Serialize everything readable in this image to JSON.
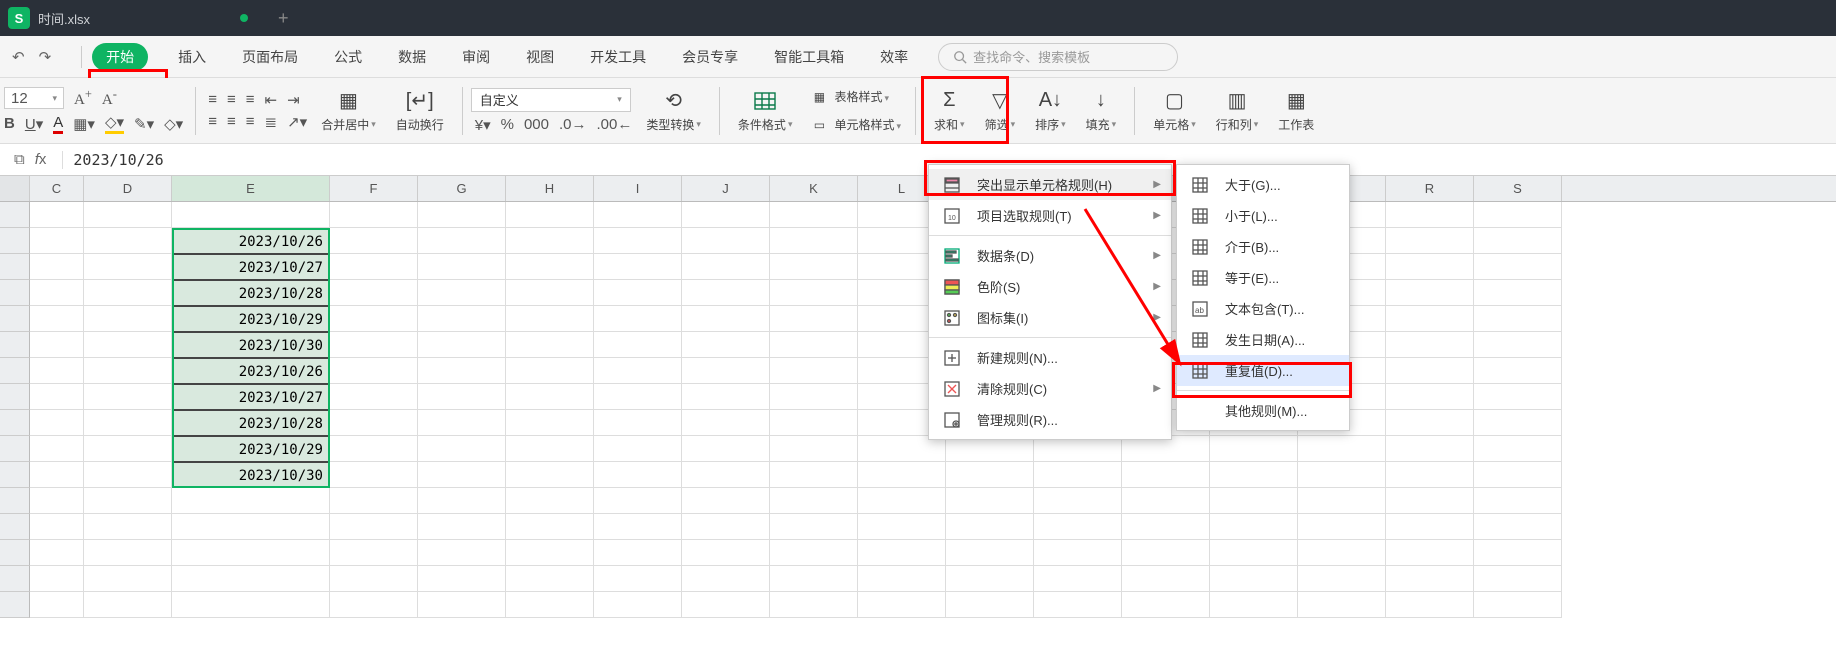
{
  "titlebar": {
    "app_letter": "S",
    "filename": "时间.xlsx",
    "new_tab": "+"
  },
  "menu": {
    "undo": "↶",
    "redo": "↷",
    "tabs": [
      "开始",
      "插入",
      "页面布局",
      "公式",
      "数据",
      "审阅",
      "视图",
      "开发工具",
      "会员专享",
      "智能工具箱",
      "效率"
    ],
    "active_index": 0,
    "search_placeholder": "查找命令、搜索模板"
  },
  "ribbon": {
    "font_size": "12",
    "merge": "合并居中",
    "wrap": "自动换行",
    "number_format": "自定义",
    "type_convert": "类型转换",
    "cond_format": "条件格式",
    "table_style": "表格样式",
    "cell_style": "单元格样式",
    "sum": "求和",
    "filter": "筛选",
    "sort": "排序",
    "fill": "填充",
    "cell": "单元格",
    "rowcol": "行和列",
    "worksheet": "工作表"
  },
  "formula_bar": {
    "value": "2023/10/26"
  },
  "columns": [
    "C",
    "D",
    "E",
    "F",
    "G",
    "H",
    "I",
    "J",
    "K",
    "L",
    "",
    "",
    "",
    "",
    "",
    "R",
    "S"
  ],
  "selected_col": "E",
  "data_cells": [
    "2023/10/26",
    "2023/10/27",
    "2023/10/28",
    "2023/10/29",
    "2023/10/30",
    "2023/10/26",
    "2023/10/27",
    "2023/10/28",
    "2023/10/29",
    "2023/10/30"
  ],
  "menu1": {
    "items": [
      {
        "icon": "highlight",
        "label": "突出显示单元格规则(H)",
        "arrow": true,
        "hl": true
      },
      {
        "icon": "top10",
        "label": "项目选取规则(T)",
        "arrow": true
      },
      {
        "sep": true
      },
      {
        "icon": "databar",
        "label": "数据条(D)",
        "arrow": true
      },
      {
        "icon": "colorscale",
        "label": "色阶(S)",
        "arrow": true
      },
      {
        "icon": "iconset",
        "label": "图标集(I)",
        "arrow": true
      },
      {
        "sep": true
      },
      {
        "icon": "newrule",
        "label": "新建规则(N)..."
      },
      {
        "icon": "clear",
        "label": "清除规则(C)",
        "arrow": true
      },
      {
        "icon": "manage",
        "label": "管理规则(R)..."
      }
    ]
  },
  "menu2": {
    "items": [
      {
        "icon": "gt",
        "label": "大于(G)..."
      },
      {
        "icon": "lt",
        "label": "小于(L)..."
      },
      {
        "icon": "between",
        "label": "介于(B)..."
      },
      {
        "icon": "eq",
        "label": "等于(E)..."
      },
      {
        "icon": "text",
        "label": "文本包含(T)..."
      },
      {
        "icon": "date",
        "label": "发生日期(A)..."
      },
      {
        "icon": "dup",
        "label": "重复值(D)...",
        "hl": true
      },
      {
        "sep": true
      },
      {
        "icon": "",
        "label": "其他规则(M)..."
      }
    ]
  }
}
